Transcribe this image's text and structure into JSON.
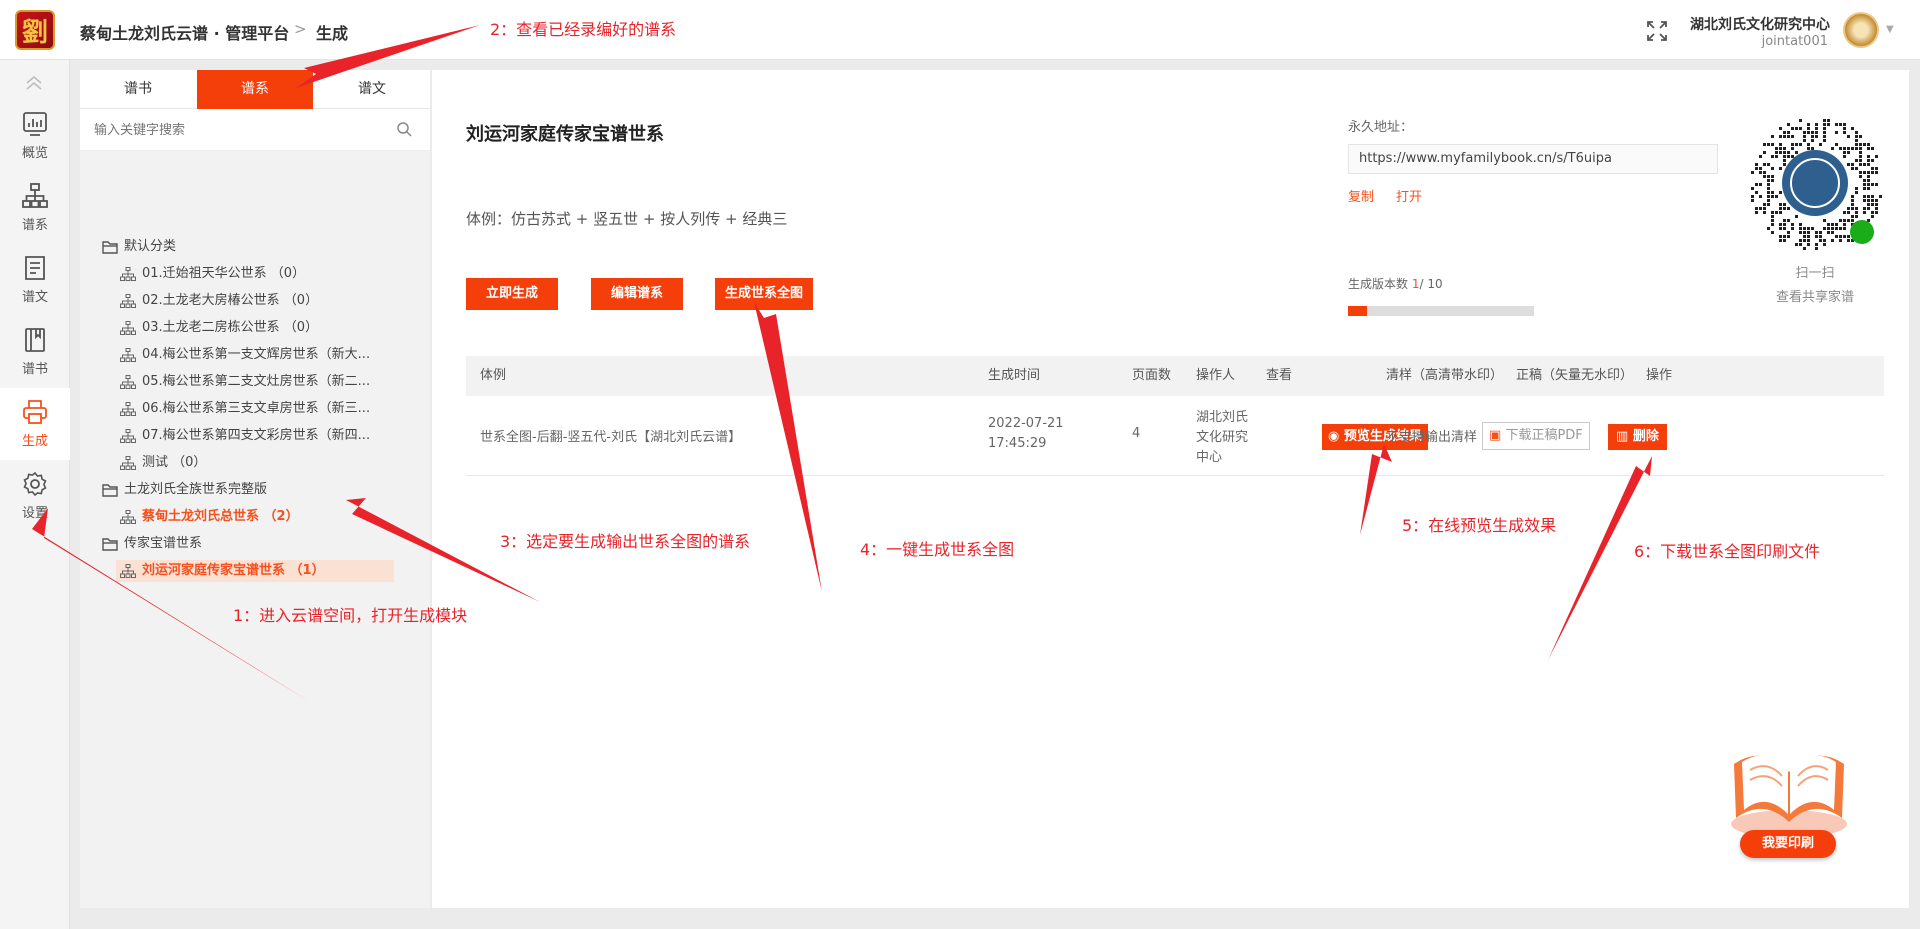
{
  "header": {
    "brand": "蔡甸土龙刘氏云谱 · 管理平台",
    "crumb_sep": ">",
    "crumb": "生成",
    "logo_char": "劉",
    "org": "湖北刘氏文化研究中心",
    "user": "jointat001"
  },
  "nav": {
    "items": [
      {
        "label": "概览",
        "icon": "chart-icon"
      },
      {
        "label": "谱系",
        "icon": "tree-icon"
      },
      {
        "label": "谱文",
        "icon": "document-icon"
      },
      {
        "label": "谱书",
        "icon": "book-icon"
      },
      {
        "label": "生成",
        "icon": "printer-icon",
        "active": true
      },
      {
        "label": "设置",
        "icon": "gear-icon"
      }
    ]
  },
  "sidebar": {
    "tabs": [
      "谱书",
      "谱系",
      "谱文"
    ],
    "active_tab": "谱系",
    "search_placeholder": "输入关键字搜索",
    "tree": [
      {
        "type": "folder",
        "label": "默认分类"
      },
      {
        "type": "leaf",
        "label": "01.迁始祖天华公世系 （0）"
      },
      {
        "type": "leaf",
        "label": "02.土龙老大房椿公世系 （0）"
      },
      {
        "type": "leaf",
        "label": "03.土龙老二房栋公世系 （0）"
      },
      {
        "type": "leaf",
        "label": "04.梅公世系第一支文辉房世系（新大..."
      },
      {
        "type": "leaf",
        "label": "05.梅公世系第二支文灶房世系（新二..."
      },
      {
        "type": "leaf",
        "label": "06.梅公世系第三支文卓房世系（新三..."
      },
      {
        "type": "leaf",
        "label": "07.梅公世系第四支文彩房世系（新四..."
      },
      {
        "type": "leaf",
        "label": "测试 （0）"
      },
      {
        "type": "folder",
        "label": "土龙刘氏全族世系完整版"
      },
      {
        "type": "leaf",
        "label": "蔡甸土龙刘氏总世系 （2）",
        "style": "bold-red"
      },
      {
        "type": "folder",
        "label": "传家宝谱世系"
      },
      {
        "type": "leaf",
        "label": "刘运河家庭传家宝谱世系 （1）",
        "style": "selected"
      }
    ]
  },
  "main": {
    "title": "刘运河家庭传家宝谱世系",
    "style_line": "体例：仿古苏式 + 竖五世 + 按人列传 + 经典三",
    "buttons": {
      "generate_now": "立即生成",
      "edit_lineage": "编辑谱系",
      "generate_full": "生成世系全图"
    },
    "permanent_label": "永久地址：",
    "permanent_url": "https://www.myfamilybook.cn/s/T6uipa",
    "copy": "复制",
    "open": "打开",
    "version_label": "生成版本数",
    "version_current": "1",
    "version_total": "/ 10",
    "version_fraction": 0.1,
    "qr_scan": "扫一扫",
    "qr_share": "查看共享家谱"
  },
  "table": {
    "headers": [
      "体例",
      "生成时间",
      "页面数",
      "操作人",
      "查看",
      "清样（高清带水印）",
      "正稿（矢量无水印）",
      "操作"
    ],
    "rows": [
      {
        "style": "世系全图-后翻-竖五代-刘氏【湖北刘氏云谱】",
        "time_date": "2022-07-21",
        "time_clock": "17:45:29",
        "pages": "4",
        "operator_1": "湖北刘氏",
        "operator_2": "文化研究",
        "operator_3": "中心",
        "preview": "预览生成结果",
        "proof": "不支持输出清样",
        "final": "下载正稿PDF",
        "delete": "删除"
      }
    ]
  },
  "promo": {
    "label": "我要印刷"
  },
  "annotations": {
    "a1": "1：进入云谱空间，打开生成模块",
    "a2": "2：查看已经录编好的谱系",
    "a3": "3：选定要生成输出世系全图的谱系",
    "a4": "4：一键生成世系全图",
    "a5": "5：在线预览生成效果",
    "a6": "6：下载世系全图印刷文件"
  },
  "colors": {
    "accent": "#f43f0b",
    "annotation": "#e8232a",
    "selected_bg": "#fbe0d4"
  }
}
